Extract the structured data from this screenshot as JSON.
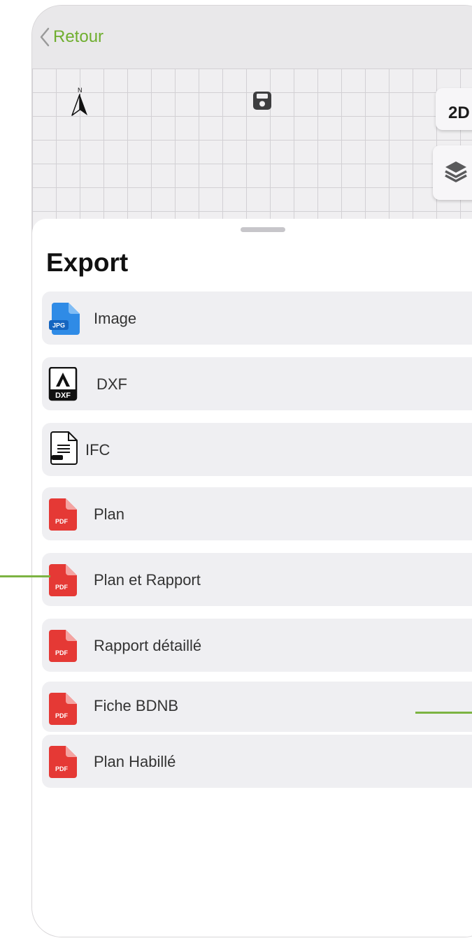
{
  "nav": {
    "back_label": "Retour",
    "compass_letter": "N"
  },
  "toolbar": {
    "view_mode_label": "2D"
  },
  "sheet": {
    "title": "Export",
    "items": [
      {
        "label": "Image",
        "icon": "jpg-file-icon",
        "badge": "JPG"
      },
      {
        "label": "DXF",
        "icon": "dxf-file-icon",
        "badge": "DXF"
      },
      {
        "label": "IFC",
        "icon": "ifc-file-icon"
      },
      {
        "label": "Plan",
        "icon": "pdf-file-icon",
        "badge": "PDF"
      },
      {
        "label": "Plan et  Rapport",
        "icon": "pdf-file-icon",
        "badge": "PDF"
      },
      {
        "label": "Rapport détaillé",
        "icon": "pdf-file-icon",
        "badge": "PDF"
      },
      {
        "label": "Fiche BDNB",
        "icon": "pdf-file-icon",
        "badge": "PDF"
      },
      {
        "label": "Plan Habillé",
        "icon": "pdf-file-icon",
        "badge": "PDF"
      }
    ]
  },
  "colors": {
    "accent": "#6fae2f",
    "pdf_red": "#e53935",
    "jpg_blue": "#2f8be6",
    "callout": "#7cb342"
  }
}
